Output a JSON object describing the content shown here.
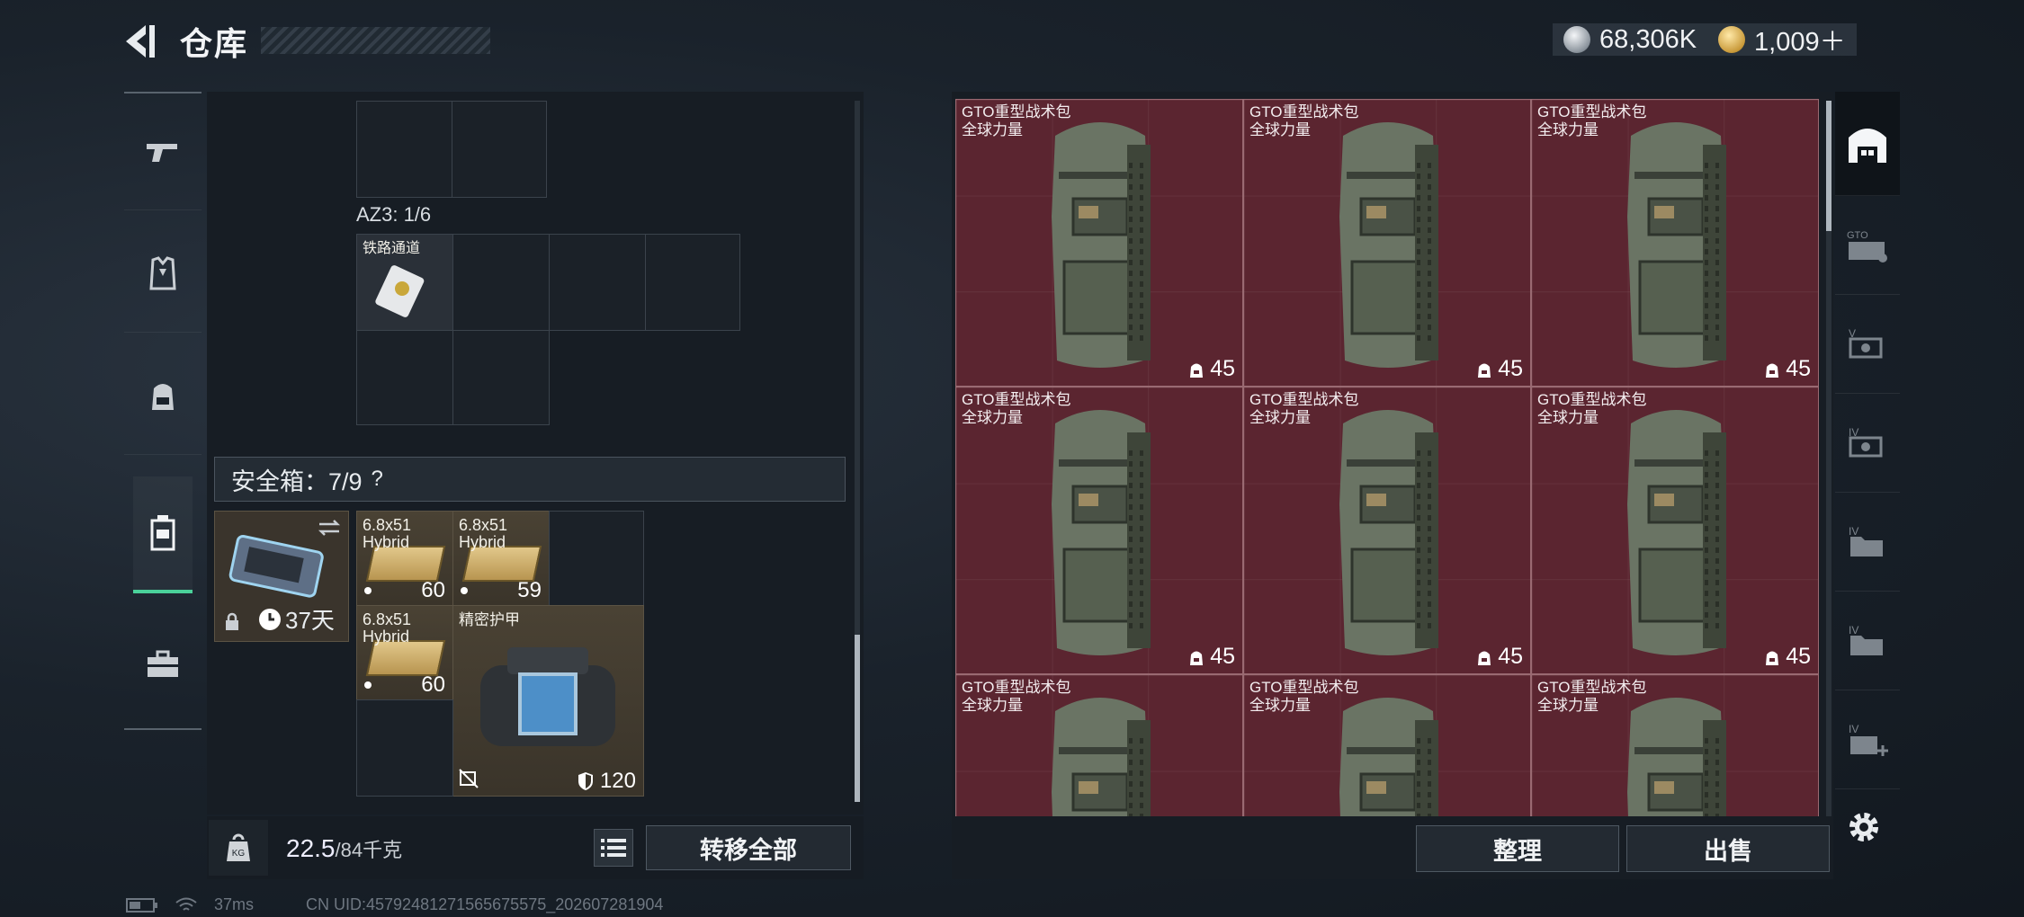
{
  "header": {
    "title": "仓库",
    "silver_amount": "68,306K",
    "gold_amount": "1,009＋"
  },
  "left_tabs": [
    "weapon-tab",
    "armor-tab",
    "backpack-tab",
    "safe-box-tab",
    "equipment-case-tab"
  ],
  "left_panel": {
    "container_label": "AZ3: 1/6",
    "item_railway_pass": "铁路通道",
    "safe_box_label": "安全箱：7/9",
    "safe_box_help": "?",
    "safe_box_timer": "37天",
    "ammo_items": [
      {
        "line1": "6.8x51",
        "line2": "Hybrid",
        "count": "60"
      },
      {
        "line1": "6.8x51",
        "line2": "Hybrid",
        "count": "59"
      },
      {
        "line1": "6.8x51",
        "line2": "Hybrid",
        "count": "60"
      }
    ],
    "armor_item": {
      "name": "精密护甲",
      "durability": "120"
    },
    "weight_value": "22.5",
    "weight_max": "/84千克",
    "transfer_all_label": "转移全部"
  },
  "right_panel": {
    "item_name": "GTO重型战术包",
    "item_faction": "全球力量",
    "item_count": "45",
    "organize_label": "整理",
    "sell_label": "出售"
  },
  "status_bar": {
    "latency": "37ms",
    "uid": "CN UID:45792481271565675575_202607281904"
  },
  "colors": {
    "accent_green": "#4ad19a",
    "tile_red": "#5b2530",
    "panel_bg": "#171d24"
  }
}
